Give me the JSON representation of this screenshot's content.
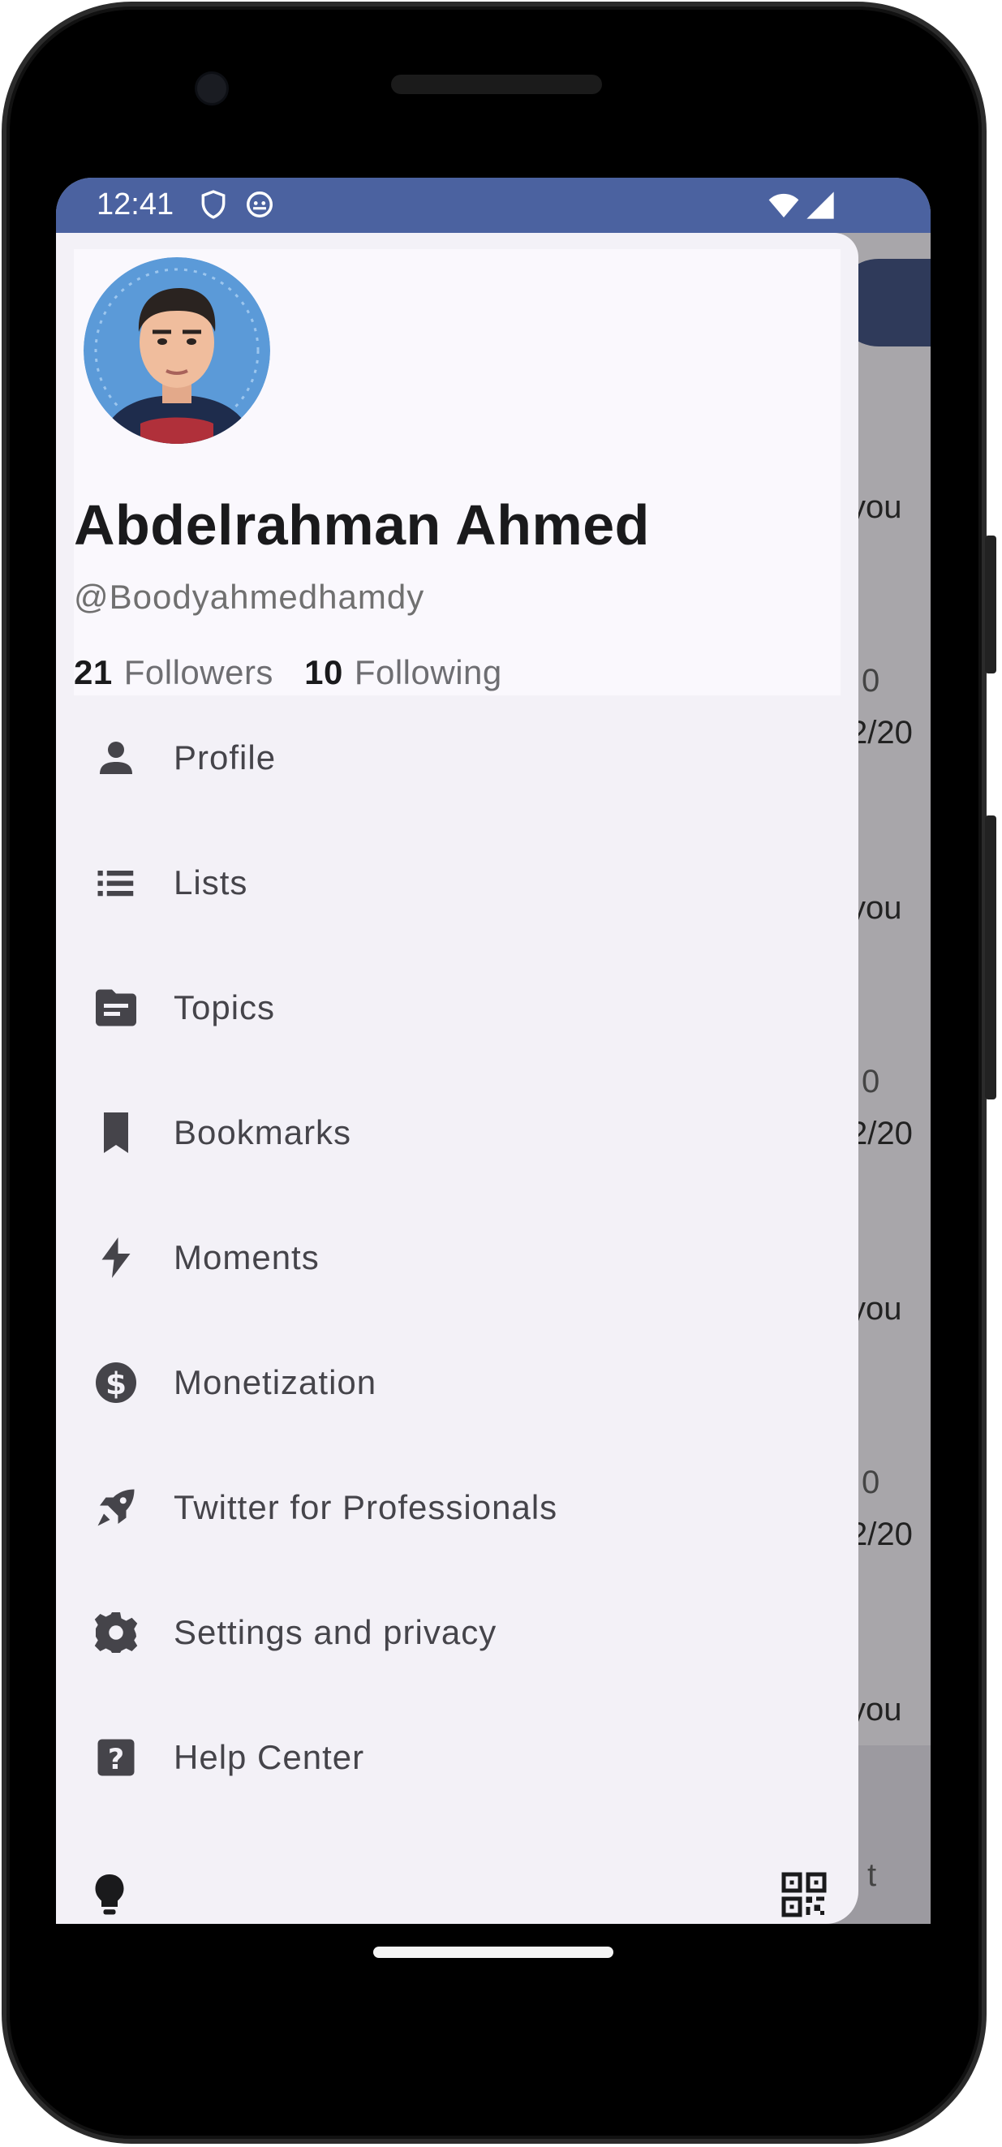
{
  "status_bar": {
    "time": "12:41"
  },
  "profile": {
    "name": "Abdelrahman Ahmed",
    "handle": "@Boodyahmedhamdy",
    "followers_count": "21",
    "followers_label": "Followers",
    "following_count": "10",
    "following_label": "Following"
  },
  "menu": {
    "items": [
      {
        "label": "Profile",
        "icon": "person-icon"
      },
      {
        "label": "Lists",
        "icon": "list-icon"
      },
      {
        "label": "Topics",
        "icon": "topic-folder-icon"
      },
      {
        "label": "Bookmarks",
        "icon": "bookmark-icon"
      },
      {
        "label": "Moments",
        "icon": "lightning-bolt-icon"
      },
      {
        "label": "Monetization",
        "icon": "dollar-icon"
      },
      {
        "label": "Twitter for Professionals",
        "icon": "rocket-icon"
      },
      {
        "label": "Settings and privacy",
        "icon": "gear-icon"
      },
      {
        "label": "Help Center",
        "icon": "help-icon"
      }
    ]
  },
  "footer": {
    "left_icon": "lightbulb-icon",
    "right_icon": "qr-code-icon"
  },
  "background": {
    "texts": [
      "you",
      "0",
      "2/20",
      "you",
      "0",
      "2/20",
      "you",
      "0",
      "2/20",
      "you",
      "t"
    ]
  },
  "colors": {
    "status_bar": "#4b62a0",
    "drawer": "#f3f1f7",
    "header": "#faf8fd",
    "icon": "#45444a"
  }
}
